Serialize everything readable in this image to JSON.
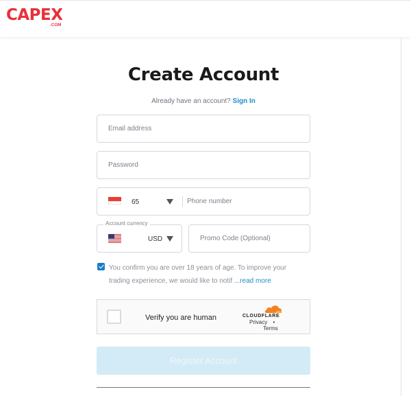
{
  "brand": {
    "logo_text": "CAPEX",
    "logo_sub": ".COM",
    "logo_color": "#e8303a"
  },
  "form": {
    "title": "Create Account",
    "have_account_text": "Already have an account?",
    "sign_in_label": "Sign In",
    "email_placeholder": "Email address",
    "password_placeholder": "Password",
    "phone": {
      "country_flag": "singapore-flag-icon",
      "dial_code": "65",
      "placeholder": "Phone number"
    },
    "currency": {
      "legend": "Account currency",
      "flag": "us-flag-icon",
      "value": "USD"
    },
    "promo_placeholder": "Promo Code (Optional)",
    "consent": {
      "checked": true,
      "text": "You confirm you are over 18 years of age. To improve your trading experience, we would like to notif ",
      "read_more": "...read more"
    },
    "captcha": {
      "label": "Verify you are human",
      "provider": "CLOUDFLARE",
      "privacy": "Privacy",
      "separator": "•",
      "terms": "Terms"
    },
    "register_label": "Register Account"
  },
  "colors": {
    "accent": "#1e8fc6",
    "button_disabled": "#d3ebf6",
    "cloudflare_orange": "#f48120"
  }
}
